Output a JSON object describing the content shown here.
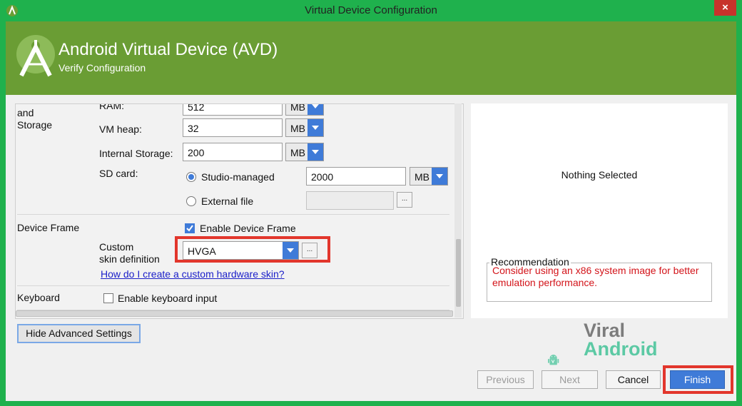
{
  "window": {
    "title": "Virtual Device Configuration",
    "close_label": "×"
  },
  "header": {
    "title": "Android Virtual Device (AVD)",
    "subtitle": "Verify Configuration"
  },
  "memory": {
    "section_label": "and\nStorage",
    "ram_label": "RAM:",
    "ram_value": "512",
    "ram_unit": "MB",
    "vmheap_label": "VM heap:",
    "vmheap_value": "32",
    "vmheap_unit": "MB",
    "internal_label": "Internal Storage:",
    "internal_value": "200",
    "internal_unit": "MB",
    "sdcard_label": "SD card:",
    "studio_managed_label": "Studio-managed",
    "studio_managed_value": "2000",
    "studio_managed_unit": "MB",
    "external_file_label": "External file",
    "external_file_value": "",
    "browse_label": "..."
  },
  "device_frame": {
    "section_label": "Device Frame",
    "enable_label": "Enable Device Frame",
    "custom_skin_label": "Custom\nskin definition",
    "skin_value": "HVGA",
    "browse_label": "...",
    "help_link": "How do I create a custom hardware skin?"
  },
  "keyboard": {
    "section_label": "Keyboard",
    "enable_label": "Enable keyboard input"
  },
  "right_panel": {
    "nothing_selected": "Nothing Selected",
    "recommendation_title": "Recommendation",
    "recommendation_text": "Consider using an x86 system image for better emulation performance."
  },
  "buttons": {
    "hide_advanced": "Hide Advanced Settings",
    "previous": "Previous",
    "next": "Next",
    "cancel": "Cancel",
    "finish": "Finish"
  },
  "watermark": {
    "line1": "Viral",
    "line2": "Android"
  },
  "colors": {
    "header_green": "#6a9d34",
    "frame_green": "#1fb14d",
    "accent_blue": "#3f7bd8",
    "highlight_red": "#e2362c",
    "warning_red": "#d3141a"
  }
}
